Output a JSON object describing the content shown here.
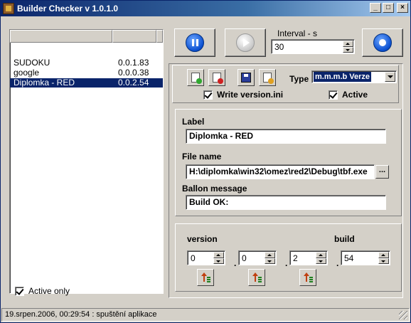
{
  "window": {
    "title": "Builder Checker v 1.0.1.0"
  },
  "list": {
    "items": [
      {
        "name": "SUDOKU",
        "version": "0.0.1.83",
        "selected": false
      },
      {
        "name": "google",
        "version": "0.0.0.38",
        "selected": false
      },
      {
        "name": "Diplomka - RED",
        "version": "0.0.2.54",
        "selected": true
      }
    ]
  },
  "active_only": {
    "label": "Active only",
    "checked": true
  },
  "interval": {
    "label": "Interval - s",
    "value": "30"
  },
  "toolbar": {
    "type_label": "Type",
    "type_value": "m.m.m.b Verze",
    "write_version_label": "Write version.ini",
    "write_version_checked": true,
    "active_label": "Active",
    "active_checked": true
  },
  "fields": {
    "label_caption": "Label",
    "label_value": "Diplomka - RED",
    "filename_caption": "File name",
    "filename_value": "H:\\diplomka\\win32\\omez\\red2\\Debug\\tbf.exe",
    "browse_label": "...",
    "ballon_caption": "Ballon message",
    "ballon_value": "Build OK:"
  },
  "version": {
    "version_caption": "version",
    "build_caption": "build",
    "v1": "0",
    "v2": "0",
    "v3": "2",
    "build": "54",
    "sep": "."
  },
  "status": {
    "text": "19.srpen.2006, 00:29:54 : spuštění aplikace"
  }
}
